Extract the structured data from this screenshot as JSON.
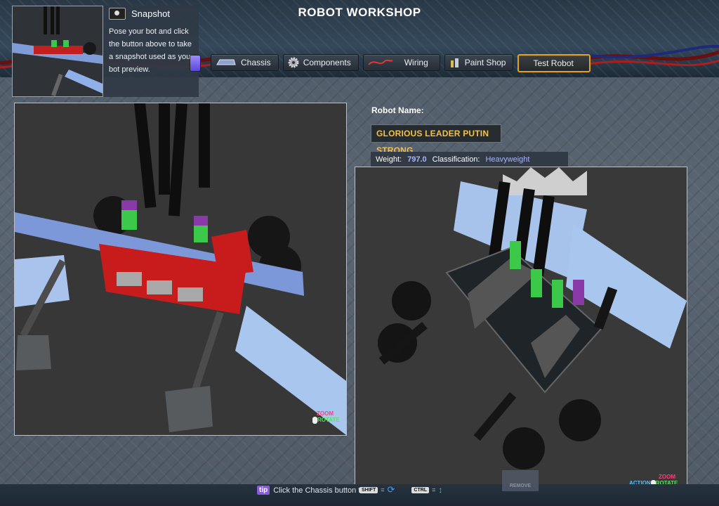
{
  "header": {
    "title": "ROBOT WORKSHOP"
  },
  "snapshot": {
    "title": "Snapshot",
    "description": "Pose your bot and click the button above to take a snapshot used as your bot preview."
  },
  "tabs": [
    {
      "label": "Chassis",
      "icon": "chassis-icon"
    },
    {
      "label": "Components",
      "icon": "gear-icon"
    },
    {
      "label": "Wiring",
      "icon": "wire-icon"
    },
    {
      "label": "Paint Shop",
      "icon": "paint-icon"
    },
    {
      "label": "Test Robot",
      "icon": ""
    }
  ],
  "robot": {
    "name_label": "Robot Name:",
    "name_value": "GLORIOUS LEADER PUTIN STRONG",
    "weight_label": "Weight:",
    "weight_value": "797.0",
    "class_label": "Classification:",
    "class_value": "Heavyweight"
  },
  "viewport_hints": {
    "zoom": "ZOOM",
    "rotate": "ROTATE",
    "action": "ACTION"
  },
  "key_hints": {
    "shift": "SHIFT",
    "ctrl": "CTRL"
  },
  "remove_label": "REMOVE",
  "tip": {
    "badge": "tip",
    "text": "Click the Chassis button t"
  },
  "colors": {
    "accent_orange": "#e3a21a",
    "name_yellow": "#f3c04a",
    "stat_blue": "#a7b4ff",
    "zoom_pink": "#ff3d7a",
    "rotate_green": "#52e25c"
  }
}
